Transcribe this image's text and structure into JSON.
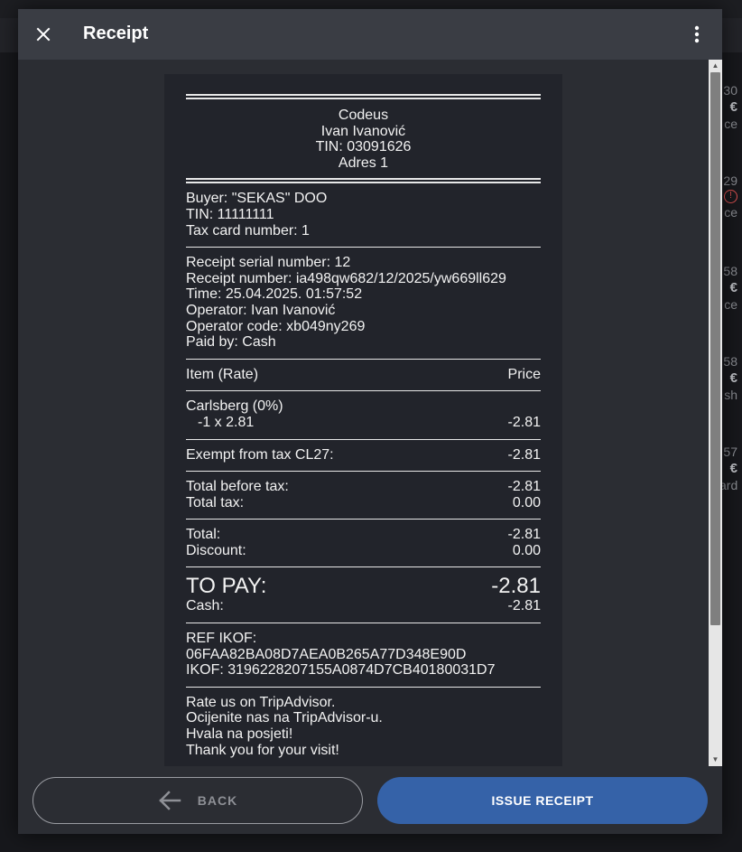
{
  "background": {
    "rows": [
      {
        "num": "30",
        "cur": "€",
        "lbl": "ce"
      },
      {
        "num": "29",
        "cur": "",
        "lbl": "ce",
        "error": true
      },
      {
        "num": "58",
        "cur": "€",
        "lbl": "ce"
      },
      {
        "num": "58",
        "cur": "€",
        "lbl": "sh"
      },
      {
        "num": "57",
        "cur": "€",
        "lbl": "ard"
      }
    ]
  },
  "dialog": {
    "title": "Receipt",
    "close_icon": "close-icon",
    "more_icon": "more-vertical-icon"
  },
  "receipt": {
    "header": {
      "company": "Codeus",
      "owner": "Ivan Ivanović",
      "tin": "TIN: 03091626",
      "address": "Adres 1"
    },
    "buyer": {
      "name": "Buyer: \"SEKAS\" DOO",
      "tin": "TIN: 11111111",
      "tax_card": "Tax card number: 1"
    },
    "info": {
      "serial": "Receipt serial number: 12",
      "number": "Receipt number: ia498qw682/12/2025/yw669ll629",
      "time": "Time: 25.04.2025. 01:57:52",
      "operator": "Operator: Ivan Ivanović",
      "operator_code": "Operator code: xb049ny269",
      "paid_by": "Paid by: Cash"
    },
    "items_header": {
      "item": "Item (Rate)",
      "price": "Price"
    },
    "items": [
      {
        "name": "Carlsberg (0%)",
        "qty_line": "-1 x 2.81",
        "price": "-2.81"
      }
    ],
    "exempt": {
      "label": "Exempt from tax CL27:",
      "value": "-2.81"
    },
    "totals1": [
      {
        "label": "Total before tax:",
        "value": "-2.81"
      },
      {
        "label": "Total tax:",
        "value": "0.00"
      }
    ],
    "totals2": [
      {
        "label": "Total:",
        "value": "-2.81"
      },
      {
        "label": "Discount:",
        "value": "0.00"
      }
    ],
    "to_pay": {
      "label": "TO PAY:",
      "value": "-2.81"
    },
    "cash": {
      "label": "Cash:",
      "value": "-2.81"
    },
    "ikof": {
      "ref": "REF IKOF: 06FAA82BA08D7AEA0B265A77D348E90D",
      "ikof": "IKOF: 3196228207155A0874D7CB40180031D7"
    },
    "footer_lines": [
      "Rate us on TripAdvisor.",
      "Ocijenite nas na TripAdvisor-u.",
      "Hvala na posjeti!",
      "Thank you for your visit!"
    ]
  },
  "actions": {
    "back_label": "BACK",
    "issue_label": "ISSUE RECEIPT"
  }
}
